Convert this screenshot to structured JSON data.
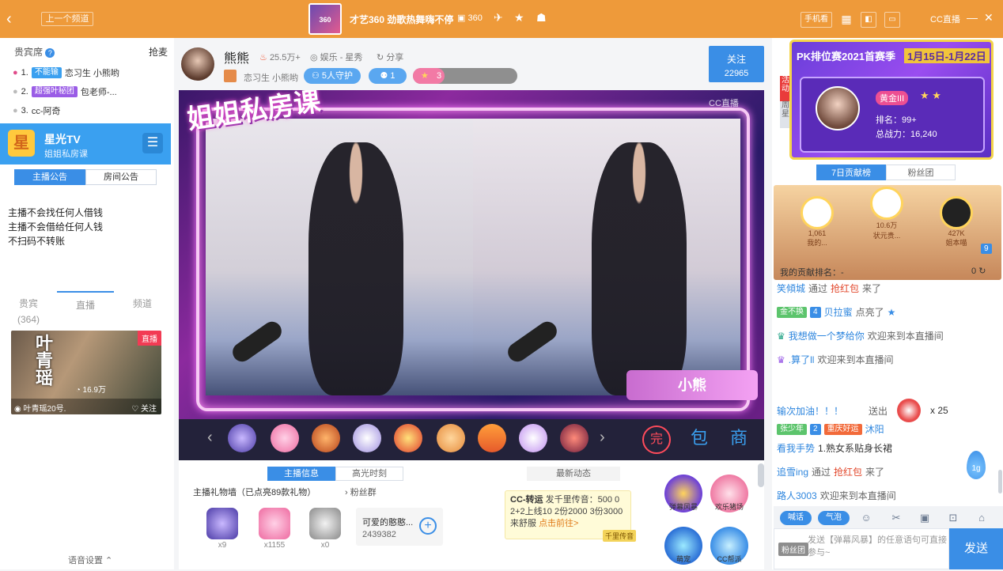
{
  "topbar": {
    "back_label": "‹",
    "prev_channel": "上一个频道",
    "logo_text": "360",
    "title": "才艺360 劲歌热舞嗨不停",
    "count": "360",
    "mobile_label": "手机看",
    "app_brand": "CC直播"
  },
  "left": {
    "section_title": "贵宾席",
    "section_action": "抢麦",
    "ranks": [
      {
        "num": "1.",
        "tag": "不能输",
        "text": "恋习生 小熊哟"
      },
      {
        "num": "2.",
        "tag": "超强叶秘团",
        "text": "包老师-..."
      },
      {
        "num": "3.",
        "tag": "",
        "text": "cc-阿奇"
      }
    ],
    "star_title": "星光TV",
    "star_sub": "姐姐私房课",
    "notice_tabs": [
      "主播公告",
      "房间公告"
    ],
    "notice_text": "主播不会找任何人借钱\n主播不会借给任何人钱\n不扫码不转账",
    "tabs": [
      {
        "label": "贵宾",
        "sub": "(364)"
      },
      {
        "label": "直播",
        "sub": ""
      },
      {
        "label": "频道",
        "sub": ""
      }
    ],
    "thumb_name": "叶青瑶",
    "thumb_live": "直播",
    "thumb_views": "16.9万",
    "thumb_channel": "叶青瑶20号.",
    "thumb_follow": "关注",
    "voice_settings": "语音设置"
  },
  "anchor": {
    "name": "熊熊",
    "heat": "25.5万+",
    "category": "娱乐 - 星秀",
    "share": "分享",
    "sub_name": "恋习生 小熊哟",
    "guards": "5人守护",
    "fans_count": "1",
    "level_value": "3",
    "level_progress": 0.3,
    "follow_label": "关注",
    "follow_count": "22965"
  },
  "video": {
    "title": "姐姐私房课",
    "watermark": "CC直播",
    "name_plate": "小熊"
  },
  "gifts": [
    "hot1",
    "hot2",
    "hot",
    "g4",
    "g5",
    "g6",
    "g7",
    "g8",
    "g9"
  ],
  "gift_buttons": [
    "完",
    "包",
    "商"
  ],
  "lower": {
    "tabs": [
      "主播信息",
      "高光时刻"
    ],
    "gift_wall": "主播礼物墙（已点亮89款礼物）",
    "fans_group": "粉丝群",
    "items": [
      {
        "count": "x9"
      },
      {
        "count": "x1155"
      },
      {
        "count": "x0"
      }
    ],
    "card_name": "可爱的憨憨...",
    "card_count": "2439382",
    "news_title": "最新动态",
    "news_head": "CC-转运",
    "news_body": "发千里传音：500 0 2+2上线10 2份2000 3份3000来舒服",
    "news_more": "点击前往>",
    "news_tag": "千里传音",
    "acts": [
      "弹幕风暴",
      "欢乐猪场",
      "萌宠",
      "CC帮派"
    ]
  },
  "right": {
    "side_tabs": [
      "活动",
      "周星"
    ],
    "pk_title": "PK排位赛2021首赛季",
    "pk_dates": "1月15日-1月22日",
    "pk_level": "黄金III",
    "pk_rank": "排名：99+",
    "pk_power": "总战力：16,240",
    "tabs": [
      "7日贡献榜",
      "粉丝团"
    ],
    "podium": [
      {
        "name": "我的...",
        "val": "1,061"
      },
      {
        "name": "状元贵...",
        "val": "10.6万"
      },
      {
        "name": "姐本喵",
        "val": "427K"
      }
    ],
    "podium_badge": "9",
    "my_rank": "我的贡献排名：-",
    "my_rank_val": "0",
    "chat": [
      {
        "user": "笑傾城",
        "mid": "通过",
        "red": "抢红包",
        "tail": "来了"
      },
      {
        "badge": "金不换",
        "lv": "4",
        "user": "贝拉蜜",
        "tail": "点亮了"
      },
      {
        "user": "我想做一个梦给你",
        "tail": "欢迎来到本直播间"
      },
      {
        "user": ".算了ll",
        "tail": "欢迎来到本直播间"
      },
      {
        "user": "输次加油！！！",
        "mid": "送出",
        "tail": "x 25"
      },
      {
        "badge": "张少年",
        "lv": "2",
        "tag": "重庆好运",
        "user": "沐阳"
      },
      {
        "user": "看我手势",
        "tail": "1.熟女系贴身长裙"
      },
      {
        "user": "追雪ing",
        "mid": "通过",
        "red": "抢红包",
        "tail": "来了"
      },
      {
        "user": "路人3003",
        "tail": "欢迎来到本直播间"
      }
    ],
    "drop_label": "1g",
    "toolbar": [
      "喊话",
      "气泡"
    ],
    "fans_badge": "粉丝团",
    "input_placeholder": "发送【弹幕风暴】的任意语句可直接参与~",
    "send_label": "发送"
  },
  "colors": {
    "orange": "#ee9a3a",
    "blue": "#3a8ee6",
    "pink": "#f23b54",
    "purple": "#6a3ed9"
  }
}
